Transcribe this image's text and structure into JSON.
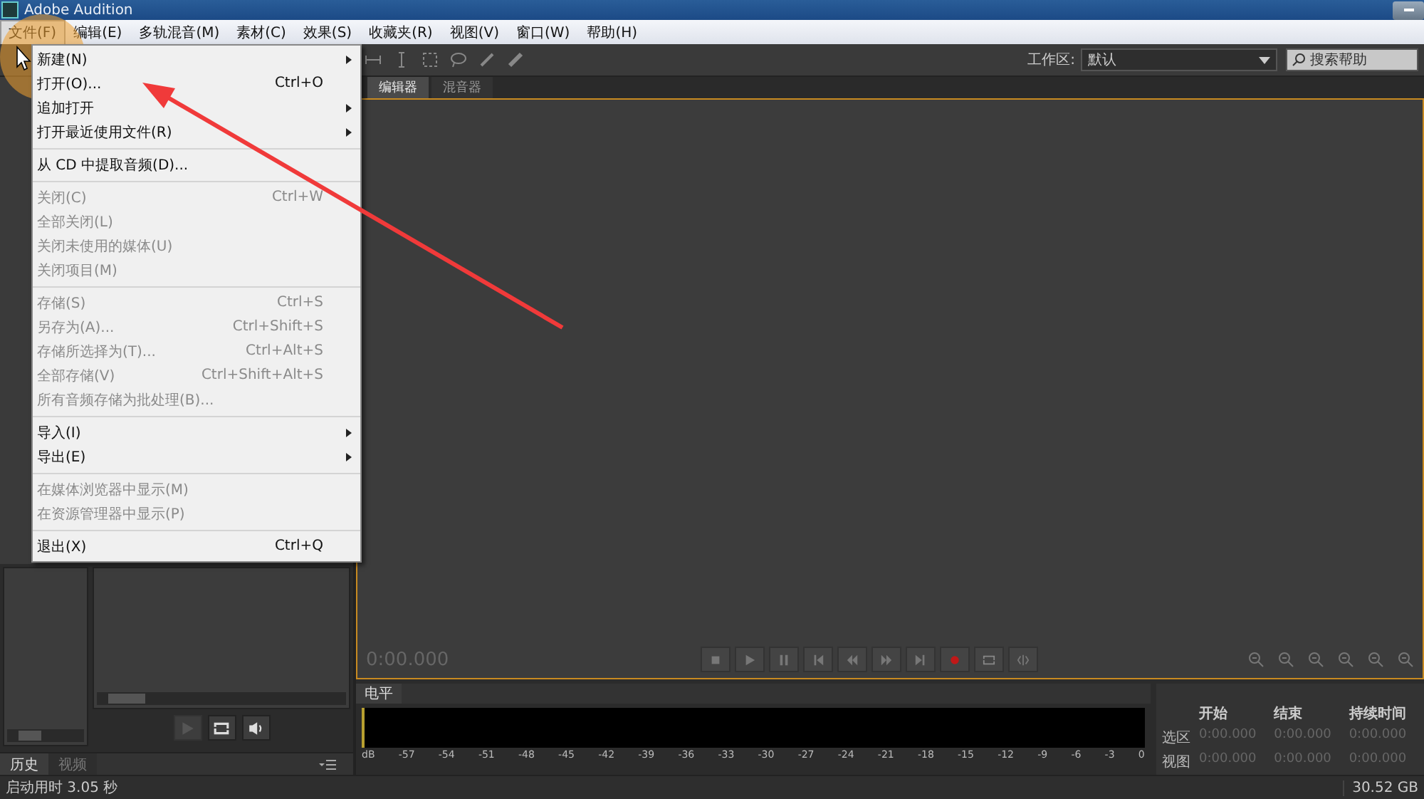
{
  "window": {
    "title": "Adobe Audition"
  },
  "menubar": [
    {
      "label": "文件(F)",
      "selected": true
    },
    {
      "label": "编辑(E)",
      "selected": false
    },
    {
      "label": "多轨混音(M)",
      "selected": false
    },
    {
      "label": "素材(C)",
      "selected": false
    },
    {
      "label": "效果(S)",
      "selected": false
    },
    {
      "label": "收藏夹(R)",
      "selected": false
    },
    {
      "label": "视图(V)",
      "selected": false
    },
    {
      "label": "窗口(W)",
      "selected": false
    },
    {
      "label": "帮助(H)",
      "selected": false
    }
  ],
  "toolbar": {
    "workspace_label": "工作区:",
    "workspace_value": "默认",
    "search": {
      "placeholder": "搜索帮助"
    }
  },
  "file_menu": [
    {
      "kind": "item",
      "label": "新建(N)",
      "disabled": false,
      "submenu": true
    },
    {
      "kind": "item",
      "label": "打开(O)...",
      "shortcut": "Ctrl+O",
      "disabled": false,
      "submenu": false
    },
    {
      "kind": "item",
      "label": "追加打开",
      "disabled": false,
      "submenu": true
    },
    {
      "kind": "item",
      "label": "打开最近使用文件(R)",
      "disabled": false,
      "submenu": true
    },
    {
      "kind": "separator"
    },
    {
      "kind": "item",
      "label": "从 CD 中提取音频(D)...",
      "disabled": false,
      "submenu": false
    },
    {
      "kind": "separator"
    },
    {
      "kind": "item",
      "label": "关闭(C)",
      "shortcut": "Ctrl+W",
      "disabled": true,
      "submenu": false
    },
    {
      "kind": "item",
      "label": "全部关闭(L)",
      "disabled": true,
      "submenu": false
    },
    {
      "kind": "item",
      "label": "关闭未使用的媒体(U)",
      "disabled": true,
      "submenu": false
    },
    {
      "kind": "item",
      "label": "关闭项目(M)",
      "disabled": true,
      "submenu": false
    },
    {
      "kind": "separator"
    },
    {
      "kind": "item",
      "label": "存储(S)",
      "shortcut": "Ctrl+S",
      "disabled": true,
      "submenu": false
    },
    {
      "kind": "item",
      "label": "另存为(A)...",
      "shortcut": "Ctrl+Shift+S",
      "disabled": true,
      "submenu": false
    },
    {
      "kind": "item",
      "label": "存储所选择为(T)...",
      "shortcut": "Ctrl+Alt+S",
      "disabled": true,
      "submenu": false
    },
    {
      "kind": "item",
      "label": "全部存储(V)",
      "shortcut": "Ctrl+Shift+Alt+S",
      "disabled": true,
      "submenu": false
    },
    {
      "kind": "item",
      "label": "所有音频存储为批处理(B)...",
      "disabled": true,
      "submenu": false
    },
    {
      "kind": "separator"
    },
    {
      "kind": "item",
      "label": "导入(I)",
      "disabled": false,
      "submenu": true
    },
    {
      "kind": "item",
      "label": "导出(E)",
      "disabled": false,
      "submenu": true
    },
    {
      "kind": "separator"
    },
    {
      "kind": "item",
      "label": "在媒体浏览器中显示(M)",
      "disabled": true,
      "submenu": false
    },
    {
      "kind": "item",
      "label": "在资源管理器中显示(P)",
      "disabled": true,
      "submenu": false
    },
    {
      "kind": "separator"
    },
    {
      "kind": "item",
      "label": "退出(X)",
      "shortcut": "Ctrl+Q",
      "disabled": false,
      "submenu": false
    }
  ],
  "editor_tabs": [
    {
      "label": "编辑器",
      "selected": true
    },
    {
      "label": "混音器",
      "selected": false
    }
  ],
  "editor": {
    "time": "0:00.000"
  },
  "left_tabs": [
    {
      "label": "历史",
      "selected": true
    },
    {
      "label": "视频",
      "selected": false
    }
  ],
  "level_panel": {
    "tab": "电平",
    "scale": [
      "dB",
      "-57",
      "-54",
      "-51",
      "-48",
      "-45",
      "-42",
      "-39",
      "-36",
      "-33",
      "-30",
      "-27",
      "-24",
      "-21",
      "-18",
      "-15",
      "-12",
      "-9",
      "-6",
      "-3",
      "0"
    ]
  },
  "selection_panel": {
    "columns": [
      "开始",
      "结束",
      "持续时间"
    ],
    "rows": [
      {
        "label": "选区",
        "values": [
          "0:00.000",
          "0:00.000",
          "0:00.000"
        ]
      },
      {
        "label": "视图",
        "values": [
          "0:00.000",
          "0:00.000",
          "0:00.000"
        ]
      }
    ]
  },
  "status_bar": {
    "message": "启动用时 3.05 秒",
    "disk_free": "30.52 GB"
  }
}
